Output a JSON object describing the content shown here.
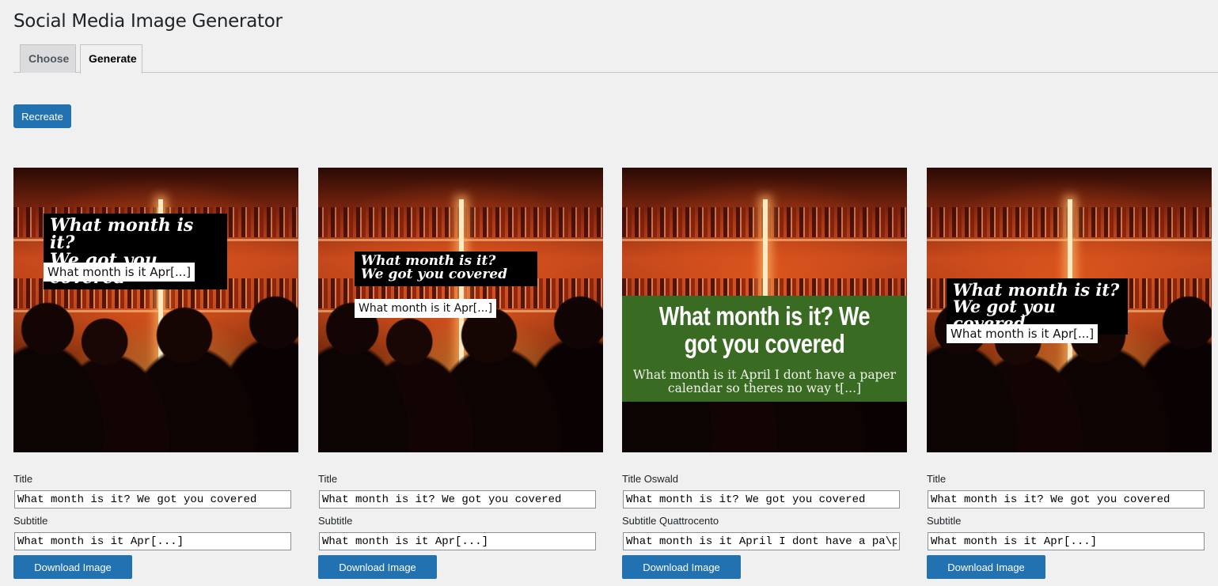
{
  "page": {
    "title": "Social Media Image Generator"
  },
  "tabs": [
    {
      "label": "Choose",
      "active": false
    },
    {
      "label": "Generate",
      "active": true
    }
  ],
  "actions": {
    "recreate_label": "Recreate"
  },
  "image_text": {
    "title_line1": "What month is it?",
    "title_line2": "We got you covered",
    "title_full": "What month is it? We got you covered",
    "subtitle_short": "What month is it Apr[...]",
    "subtitle_long": "What month is it April I dont have a paper calendar so theres no way t[...]"
  },
  "cards": [
    {
      "title_label": "Title",
      "title_value": "What month is it? We got you covered",
      "subtitle_label": "Subtitle",
      "subtitle_value": "What month is it Apr[...]",
      "download_label": "Download Image"
    },
    {
      "title_label": "Title",
      "title_value": "What month is it? We got you covered",
      "subtitle_label": "Subtitle",
      "subtitle_value": "What month is it Apr[...]",
      "download_label": "Download Image"
    },
    {
      "title_label": "Title Oswald",
      "title_value": "What month is it? We got you covered",
      "subtitle_label": "Subtitle Quattrocento",
      "subtitle_value": "What month is it April I dont have a pa\\paper",
      "download_label": "Download Image"
    },
    {
      "title_label": "Title",
      "title_value": "What month is it? We got you covered",
      "subtitle_label": "Subtitle",
      "subtitle_value": "What month is it Apr[...]",
      "download_label": "Download Image"
    }
  ],
  "colors": {
    "accent": "#2271b1",
    "background": "#f0f0f1",
    "green_band": "#3a6b22"
  }
}
